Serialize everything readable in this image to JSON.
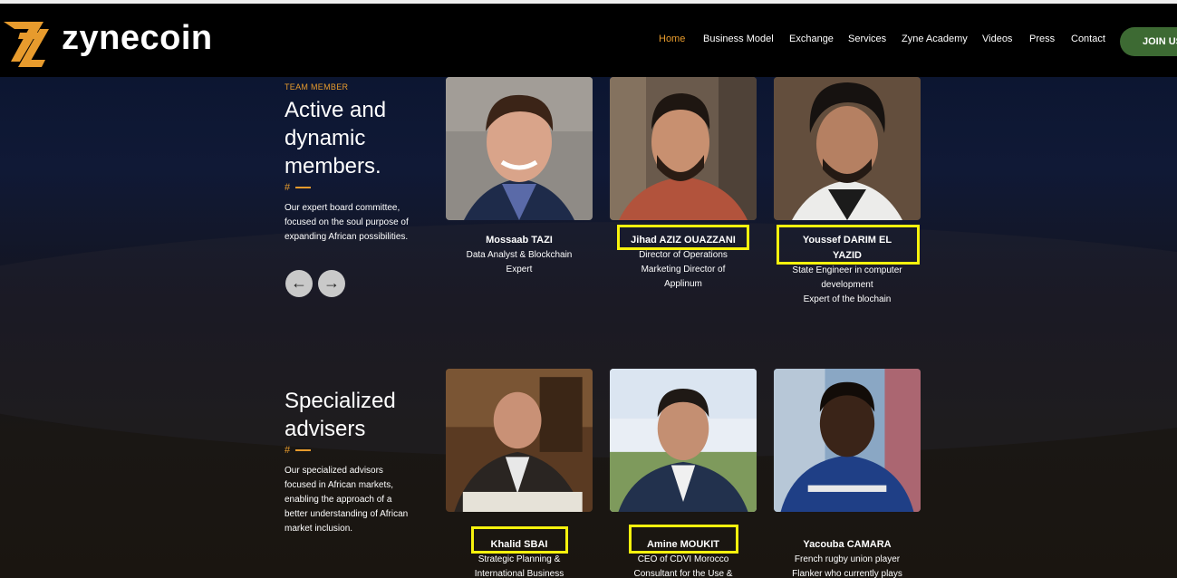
{
  "header": {
    "brand": "zynecoin",
    "nav": [
      "Home",
      "Business Model",
      "Exchange",
      "Services",
      "Zyne Academy",
      "Videos",
      "Press",
      "Contact"
    ],
    "active_nav": "Home",
    "join_label": "JOIN US"
  },
  "team": {
    "kicker": "TEAM MEMBER",
    "heading_lines": [
      "Active and",
      "dynamic",
      "members."
    ],
    "divider": "#",
    "description_lines": [
      "Our expert board committee,",
      "focused on the soul purpose of",
      "expanding African possibilities."
    ],
    "members": [
      {
        "name": "Mossaab TAZI",
        "role_lines": [
          "Data Analyst & Blockchain",
          "Expert"
        ]
      },
      {
        "name": "Jihad AZIZ OUAZZANI",
        "role_lines": [
          "Director of Operations",
          "Marketing Director of",
          "Applinum"
        ]
      },
      {
        "name_lines": [
          "Youssef DARIM EL",
          "YAZID"
        ],
        "role_lines": [
          "State Engineer in computer",
          "development",
          "Expert of the blochain"
        ]
      }
    ]
  },
  "advisers": {
    "heading_lines": [
      "Specialized",
      "advisers"
    ],
    "divider": "#",
    "description_lines": [
      "Our specialized advisors",
      "focused in African markets,",
      "enabling the approach of a",
      "better understanding of African",
      "market inclusion."
    ],
    "members": [
      {
        "name": "Khalid SBAI",
        "role_lines": [
          "Strategic Planning &",
          "International Business"
        ]
      },
      {
        "name": "Amine MOUKIT",
        "role_lines": [
          "CEO of CDVI Morocco",
          "Consultant for the Use &"
        ]
      },
      {
        "name": "Yacouba CAMARA",
        "role_lines": [
          "French rugby union player",
          "Flanker who currently plays"
        ]
      }
    ]
  },
  "colors": {
    "accent": "#e79b2d",
    "join_bg": "#3d6a33",
    "highlight": "#f7f20d"
  }
}
